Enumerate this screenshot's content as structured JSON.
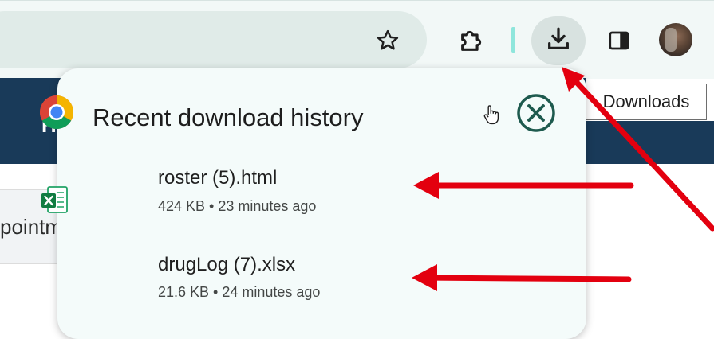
{
  "tooltip": {
    "text": "Downloads"
  },
  "site": {
    "header_letter": "H",
    "nav_text": "pointm"
  },
  "toolbar": {
    "icons": [
      "star-icon",
      "puzzle-extension-icon",
      "download-icon",
      "side-panel-icon",
      "profile-avatar"
    ]
  },
  "popup": {
    "title": "Recent download history",
    "items": [
      {
        "name": "roster (5).html",
        "size": "424 KB",
        "time": "23 minutes ago",
        "icon": "chrome-icon"
      },
      {
        "name": "drugLog (7).xlsx",
        "size": "21.6 KB",
        "time": "24 minutes ago",
        "icon": "excel-icon"
      }
    ]
  },
  "colors": {
    "toolbar_bg": "#f2f8f7",
    "popup_bg": "#f4fbfa",
    "close_icon": "#1e5a4e",
    "site_header": "#193a59",
    "arrow": "#e3000f"
  }
}
